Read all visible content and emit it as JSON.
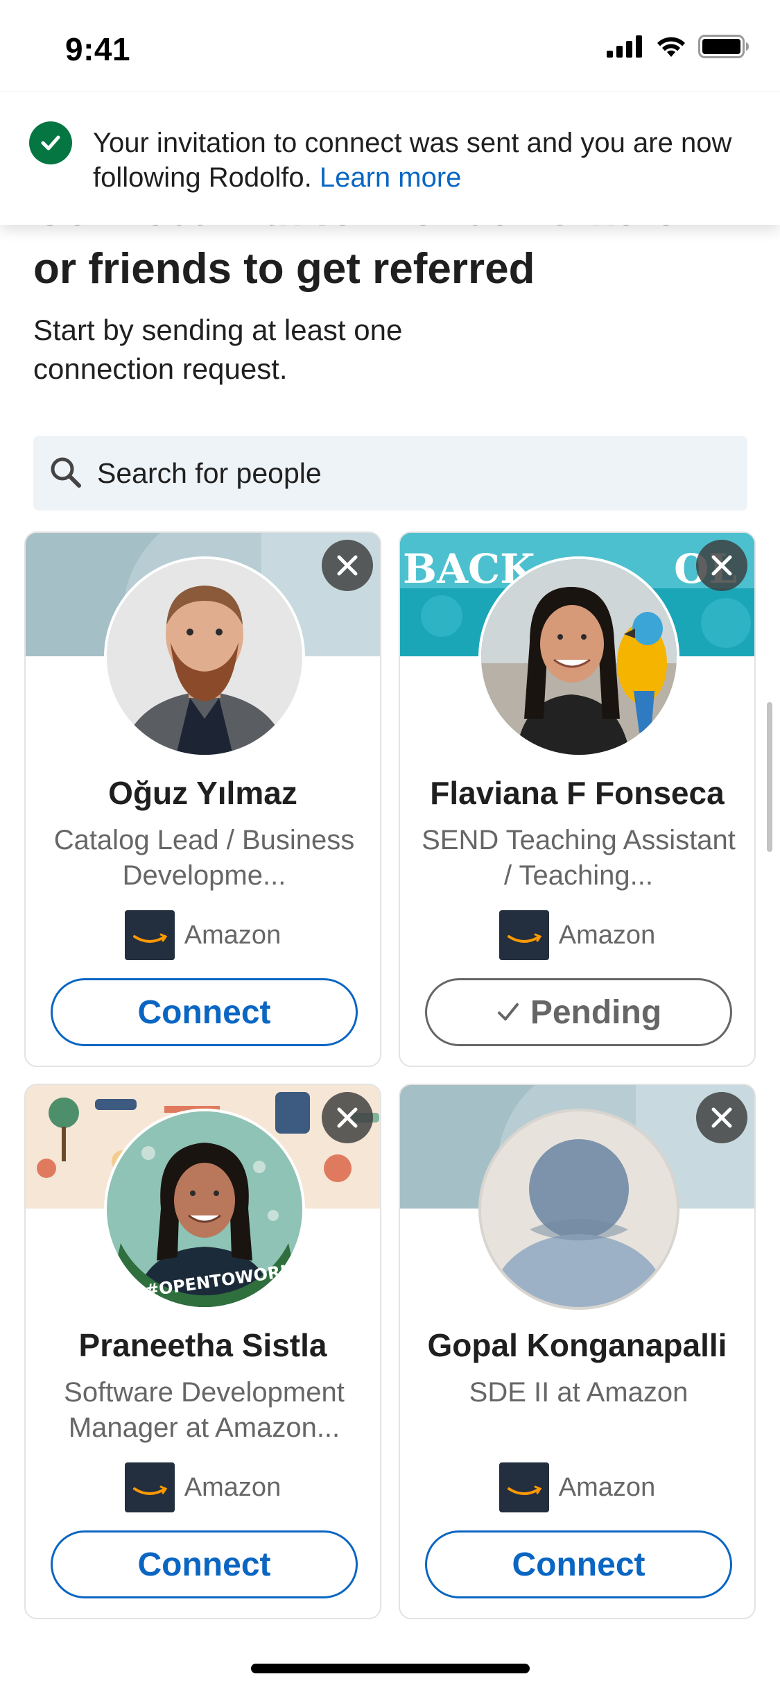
{
  "status_bar": {
    "time": "9:41",
    "icons": [
      "cellular-signal-icon",
      "wifi-icon",
      "battery-icon"
    ]
  },
  "toast": {
    "message": "Your invitation to connect was sent and you are now following Rodolfo.",
    "link_label": "Learn more",
    "icon": "check-circle-icon",
    "accent_color": "#057642"
  },
  "heading": {
    "partial_line": "Connect with former coworkers",
    "title": "or friends to get referred",
    "subtitle": "Start by sending at least one connection request."
  },
  "search": {
    "placeholder": "Search for people",
    "icon": "search-icon"
  },
  "people": [
    {
      "name": "Oğuz Yılmaz",
      "occupation": "Catalog Lead / Business Developme...",
      "company": "Amazon",
      "action": "Connect",
      "state": "connect"
    },
    {
      "name": "Flaviana F Fonseca",
      "occupation": "SEND Teaching Assistant / Teaching...",
      "company": "Amazon",
      "action": "Pending",
      "state": "pending"
    },
    {
      "name": "Praneetha Sistla",
      "occupation": "Software Development Manager at Amazon...",
      "company": "Amazon",
      "action": "Connect",
      "state": "connect",
      "badge": "#OPENTOWORK"
    },
    {
      "name": "Gopal Konganapalli",
      "occupation": "SDE II at Amazon",
      "company": "Amazon",
      "action": "Connect",
      "state": "connect"
    }
  ],
  "colors": {
    "primary": "#0a66c2",
    "success": "#057642",
    "muted_text": "#666666",
    "search_bg": "#eef3f8"
  }
}
